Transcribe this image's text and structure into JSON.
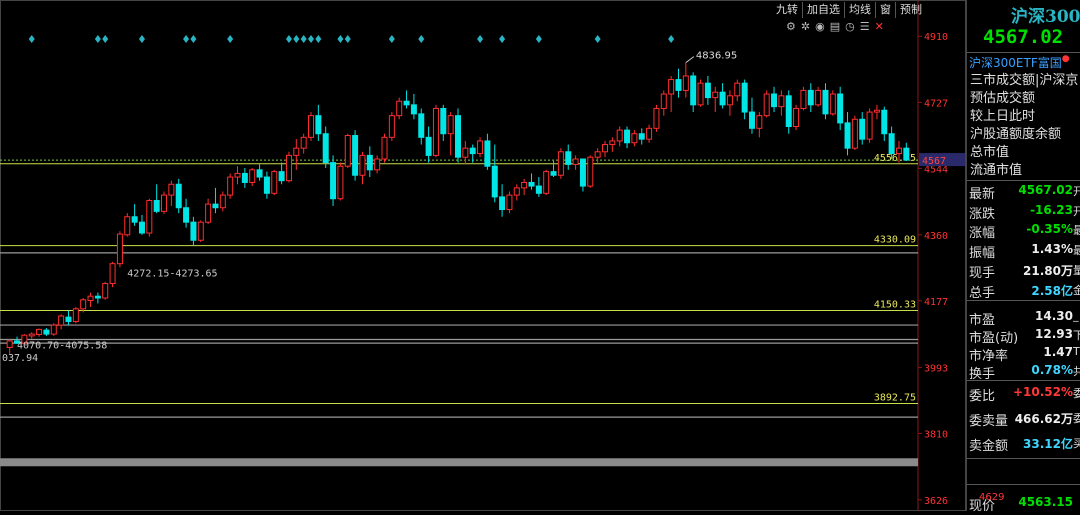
{
  "toolbar": {
    "buttons": [
      "九转",
      "加自选",
      "均线",
      "窗",
      "预制"
    ],
    "icons": [
      "gear-icon",
      "settings-cog-icon",
      "eye-icon",
      "layout-icon",
      "clock-icon",
      "menu-icon",
      "close-icon"
    ]
  },
  "panel": {
    "title": "沪深300",
    "price": "4567.02",
    "etf_link": "沪深300ETF富国",
    "info_lines": [
      "三市成交额|沪深京",
      "预估成交额",
      "较上日此时",
      "沪股通额度余额",
      "总市值",
      "流通市值"
    ],
    "quotes": [
      {
        "label": "最新",
        "value": "4567.02",
        "color": "green",
        "tail": "开"
      },
      {
        "label": "涨跌",
        "value": "-16.23",
        "color": "green",
        "tail": "开"
      },
      {
        "label": "涨幅",
        "value": "-0.35%",
        "color": "green",
        "tail": "最"
      },
      {
        "label": "振幅",
        "value": "1.43%",
        "color": "white",
        "tail": "最"
      },
      {
        "label": "现手",
        "value": "21.80万",
        "color": "white",
        "tail": "量"
      },
      {
        "label": "总手",
        "value": "2.58亿",
        "color": "cyan",
        "tail": "金"
      },
      {
        "label": "市盈",
        "value": "14.30",
        "color": "white",
        "tail": "_"
      },
      {
        "label": "市盈(动)",
        "value": "12.93",
        "color": "white",
        "tail": "下"
      },
      {
        "label": "市净率",
        "value": "1.47",
        "color": "white",
        "tail": "T"
      },
      {
        "label": "换手",
        "value": "0.78%",
        "color": "cyan",
        "tail": "共"
      },
      {
        "label": "委比",
        "value": "+10.52%",
        "color": "red",
        "tail": "委"
      },
      {
        "label": "委卖量",
        "value": "466.62万",
        "color": "white",
        "tail": "委"
      },
      {
        "label": "卖金额",
        "value": "33.12亿",
        "color": "cyan",
        "tail": "买"
      },
      {
        "label": "现价",
        "value": "4563.15",
        "color": "green",
        "tail": ""
      }
    ],
    "mini_label": "4629"
  },
  "colors": {
    "up": "#ff2e2e",
    "down": "#00e5e5",
    "axis_text": "#ff3333",
    "hline": "#c8e04a",
    "grey_line": "#9a9a9a",
    "diamond": "#29b5c4"
  },
  "chart_data": {
    "type": "candlestick",
    "title": "沪深300",
    "y_axis_ticks": [
      4910,
      4727,
      4544,
      4360,
      4177,
      3993,
      3810,
      3626
    ],
    "current_price_tag": "4567",
    "ylim": [
      3595,
      4955
    ],
    "high_label": "4836.95",
    "ohlc": [
      [
        4048,
        4072,
        4030,
        4066
      ],
      [
        4066,
        4078,
        4058,
        4060
      ],
      [
        4060,
        4085,
        4055,
        4082
      ],
      [
        4080,
        4090,
        4072,
        4085
      ],
      [
        4084,
        4100,
        4078,
        4098
      ],
      [
        4096,
        4102,
        4080,
        4085
      ],
      [
        4085,
        4115,
        4080,
        4110
      ],
      [
        4110,
        4140,
        4098,
        4135
      ],
      [
        4132,
        4150,
        4110,
        4120
      ],
      [
        4120,
        4160,
        4115,
        4155
      ],
      [
        4155,
        4185,
        4145,
        4180
      ],
      [
        4178,
        4200,
        4160,
        4190
      ],
      [
        4190,
        4200,
        4170,
        4185
      ],
      [
        4185,
        4230,
        4180,
        4225
      ],
      [
        4225,
        4285,
        4215,
        4280
      ],
      [
        4280,
        4370,
        4270,
        4362
      ],
      [
        4360,
        4420,
        4355,
        4410
      ],
      [
        4410,
        4445,
        4385,
        4395
      ],
      [
        4395,
        4415,
        4360,
        4365
      ],
      [
        4365,
        4460,
        4355,
        4455
      ],
      [
        4455,
        4500,
        4420,
        4425
      ],
      [
        4425,
        4480,
        4418,
        4470
      ],
      [
        4470,
        4510,
        4440,
        4500
      ],
      [
        4500,
        4515,
        4420,
        4435
      ],
      [
        4435,
        4460,
        4380,
        4395
      ],
      [
        4395,
        4410,
        4330,
        4345
      ],
      [
        4345,
        4400,
        4340,
        4395
      ],
      [
        4395,
        4460,
        4390,
        4445
      ],
      [
        4445,
        4490,
        4420,
        4435
      ],
      [
        4435,
        4480,
        4425,
        4470
      ],
      [
        4470,
        4530,
        4460,
        4520
      ],
      [
        4520,
        4550,
        4500,
        4530
      ],
      [
        4530,
        4545,
        4490,
        4505
      ],
      [
        4505,
        4545,
        4495,
        4540
      ],
      [
        4540,
        4555,
        4510,
        4520
      ],
      [
        4520,
        4535,
        4460,
        4475
      ],
      [
        4475,
        4540,
        4470,
        4535
      ],
      [
        4535,
        4560,
        4500,
        4510
      ],
      [
        4510,
        4590,
        4505,
        4580
      ],
      [
        4580,
        4625,
        4540,
        4600
      ],
      [
        4600,
        4640,
        4585,
        4630
      ],
      [
        4630,
        4700,
        4620,
        4690
      ],
      [
        4690,
        4720,
        4620,
        4640
      ],
      [
        4640,
        4660,
        4545,
        4560
      ],
      [
        4560,
        4580,
        4440,
        4460
      ],
      [
        4460,
        4560,
        4455,
        4550
      ],
      [
        4550,
        4640,
        4545,
        4635
      ],
      [
        4635,
        4650,
        4510,
        4525
      ],
      [
        4525,
        4590,
        4500,
        4580
      ],
      [
        4580,
        4605,
        4520,
        4540
      ],
      [
        4540,
        4580,
        4530,
        4570
      ],
      [
        4570,
        4640,
        4560,
        4630
      ],
      [
        4630,
        4700,
        4620,
        4690
      ],
      [
        4690,
        4740,
        4680,
        4730
      ],
      [
        4730,
        4760,
        4710,
        4720
      ],
      [
        4720,
        4750,
        4680,
        4695
      ],
      [
        4695,
        4710,
        4610,
        4630
      ],
      [
        4630,
        4660,
        4560,
        4580
      ],
      [
        4580,
        4720,
        4575,
        4710
      ],
      [
        4710,
        4720,
        4620,
        4640
      ],
      [
        4640,
        4700,
        4580,
        4690
      ],
      [
        4690,
        4710,
        4560,
        4575
      ],
      [
        4575,
        4620,
        4555,
        4600
      ],
      [
        4600,
        4610,
        4560,
        4585
      ],
      [
        4585,
        4630,
        4575,
        4620
      ],
      [
        4620,
        4640,
        4540,
        4550
      ],
      [
        4550,
        4610,
        4450,
        4465
      ],
      [
        4465,
        4500,
        4410,
        4430
      ],
      [
        4430,
        4480,
        4420,
        4470
      ],
      [
        4470,
        4500,
        4455,
        4490
      ],
      [
        4490,
        4515,
        4470,
        4505
      ],
      [
        4505,
        4530,
        4485,
        4495
      ],
      [
        4495,
        4520,
        4465,
        4475
      ],
      [
        4475,
        4540,
        4470,
        4535
      ],
      [
        4535,
        4565,
        4520,
        4525
      ],
      [
        4525,
        4600,
        4515,
        4590
      ],
      [
        4590,
        4610,
        4540,
        4555
      ],
      [
        4555,
        4580,
        4540,
        4570
      ],
      [
        4570,
        4560,
        4480,
        4495
      ],
      [
        4495,
        4580,
        4490,
        4575
      ],
      [
        4575,
        4600,
        4560,
        4590
      ],
      [
        4590,
        4620,
        4575,
        4610
      ],
      [
        4610,
        4630,
        4590,
        4620
      ],
      [
        4620,
        4660,
        4605,
        4650
      ],
      [
        4650,
        4660,
        4600,
        4615
      ],
      [
        4615,
        4650,
        4605,
        4640
      ],
      [
        4640,
        4655,
        4610,
        4625
      ],
      [
        4625,
        4665,
        4615,
        4655
      ],
      [
        4655,
        4720,
        4645,
        4710
      ],
      [
        4710,
        4760,
        4690,
        4750
      ],
      [
        4750,
        4800,
        4700,
        4790
      ],
      [
        4790,
        4820,
        4740,
        4760
      ],
      [
        4760,
        4837,
        4740,
        4800
      ],
      [
        4800,
        4810,
        4700,
        4720
      ],
      [
        4720,
        4790,
        4715,
        4780
      ],
      [
        4780,
        4800,
        4720,
        4740
      ],
      [
        4740,
        4770,
        4700,
        4755
      ],
      [
        4755,
        4780,
        4710,
        4720
      ],
      [
        4720,
        4760,
        4690,
        4745
      ],
      [
        4745,
        4790,
        4730,
        4780
      ],
      [
        4780,
        4790,
        4680,
        4700
      ],
      [
        4700,
        4740,
        4640,
        4655
      ],
      [
        4655,
        4700,
        4630,
        4690
      ],
      [
        4690,
        4760,
        4685,
        4750
      ],
      [
        4750,
        4770,
        4700,
        4715
      ],
      [
        4715,
        4760,
        4690,
        4745
      ],
      [
        4745,
        4760,
        4640,
        4660
      ],
      [
        4660,
        4720,
        4650,
        4710
      ],
      [
        4710,
        4770,
        4705,
        4760
      ],
      [
        4760,
        4780,
        4700,
        4720
      ],
      [
        4720,
        4770,
        4715,
        4760
      ],
      [
        4760,
        4780,
        4680,
        4695
      ],
      [
        4695,
        4760,
        4690,
        4750
      ],
      [
        4750,
        4770,
        4650,
        4670
      ],
      [
        4670,
        4700,
        4580,
        4600
      ],
      [
        4600,
        4690,
        4595,
        4680
      ],
      [
        4680,
        4700,
        4610,
        4625
      ],
      [
        4625,
        4710,
        4615,
        4700
      ],
      [
        4700,
        4720,
        4680,
        4705
      ],
      [
        4705,
        4715,
        4620,
        4640
      ],
      [
        4640,
        4660,
        4570,
        4585
      ],
      [
        4585,
        4620,
        4560,
        4600
      ],
      [
        4600,
        4615,
        4565,
        4567
      ]
    ],
    "diamond_candle_index": [
      3,
      12,
      13,
      18,
      24,
      25,
      30,
      38,
      39,
      40,
      41,
      42,
      45,
      46,
      52,
      56,
      64,
      67,
      72,
      80,
      90
    ],
    "horizontal_levels": [
      {
        "value": 4330.09,
        "label": "4330.09",
        "kind": "level"
      },
      {
        "value": 4150.33,
        "label": "4150.33",
        "kind": "level"
      },
      {
        "value": 3892.75,
        "label": "3892.75",
        "kind": "level"
      },
      {
        "value": 4556.75,
        "label": "4556.75",
        "kind": "level"
      },
      {
        "value": 4310,
        "label": "",
        "kind": "grey"
      },
      {
        "value": 4110,
        "label": "",
        "kind": "grey"
      },
      {
        "value": 4060,
        "label": "",
        "kind": "grey"
      },
      {
        "value": 4070,
        "label": "",
        "kind": "grey"
      },
      {
        "value": 3855,
        "label": "",
        "kind": "grey"
      },
      {
        "value": 3730,
        "label": "",
        "kind": "greyband"
      }
    ],
    "annotations": [
      {
        "text": "4272.15-4273.65",
        "value": 4272.9,
        "candle_index": 16
      },
      {
        "text": "4070.70-4075.58",
        "value": 4073,
        "candle_index": 1
      },
      {
        "text": "037.94",
        "value": 4037.94,
        "candle_index": 0
      }
    ]
  }
}
